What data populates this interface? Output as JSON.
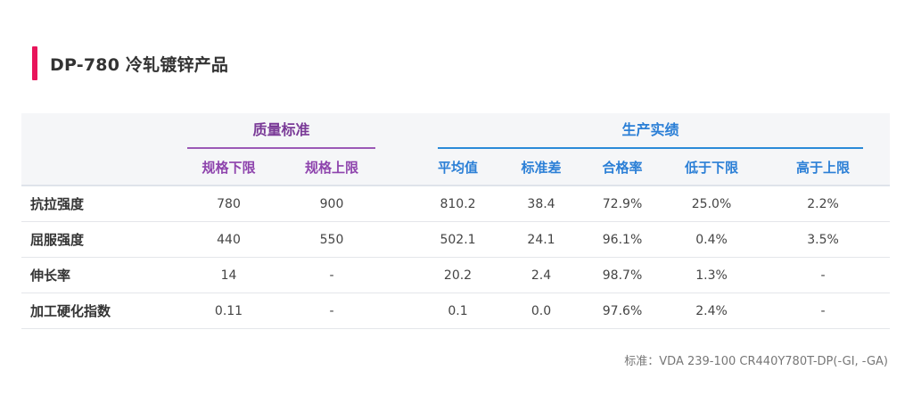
{
  "title": "DP-780 冷轧镀锌产品",
  "accent_color": "#e8155b",
  "table": {
    "groups": {
      "quality_standard": "质量标准",
      "production_performance": "生产实绩"
    },
    "columns": {
      "spec_lower": "规格下限",
      "spec_upper": "规格上限",
      "average": "平均值",
      "std_dev": "标准差",
      "pass_rate": "合格率",
      "below_lower": "低于下限",
      "above_upper": "高于上限"
    },
    "rows": [
      {
        "label": "抗拉强度",
        "spec_lower": "780",
        "spec_upper": "900",
        "average": "810.2",
        "std_dev": "38.4",
        "pass_rate": "72.9%",
        "below_lower": "25.0%",
        "above_upper": "2.2%"
      },
      {
        "label": "屈服强度",
        "spec_lower": "440",
        "spec_upper": "550",
        "average": "502.1",
        "std_dev": "24.1",
        "pass_rate": "96.1%",
        "below_lower": "0.4%",
        "above_upper": "3.5%"
      },
      {
        "label": "伸长率",
        "spec_lower": "14",
        "spec_upper": "-",
        "average": "20.2",
        "std_dev": "2.4",
        "pass_rate": "98.7%",
        "below_lower": "1.3%",
        "above_upper": "-"
      },
      {
        "label": "加工硬化指数",
        "spec_lower": "0.11",
        "spec_upper": "-",
        "average": "0.1",
        "std_dev": "0.0",
        "pass_rate": "97.6%",
        "below_lower": "2.4%",
        "above_upper": "-"
      }
    ]
  },
  "footnote": "标准：VDA 239-100 CR440Y780T-DP(-GI, -GA)"
}
